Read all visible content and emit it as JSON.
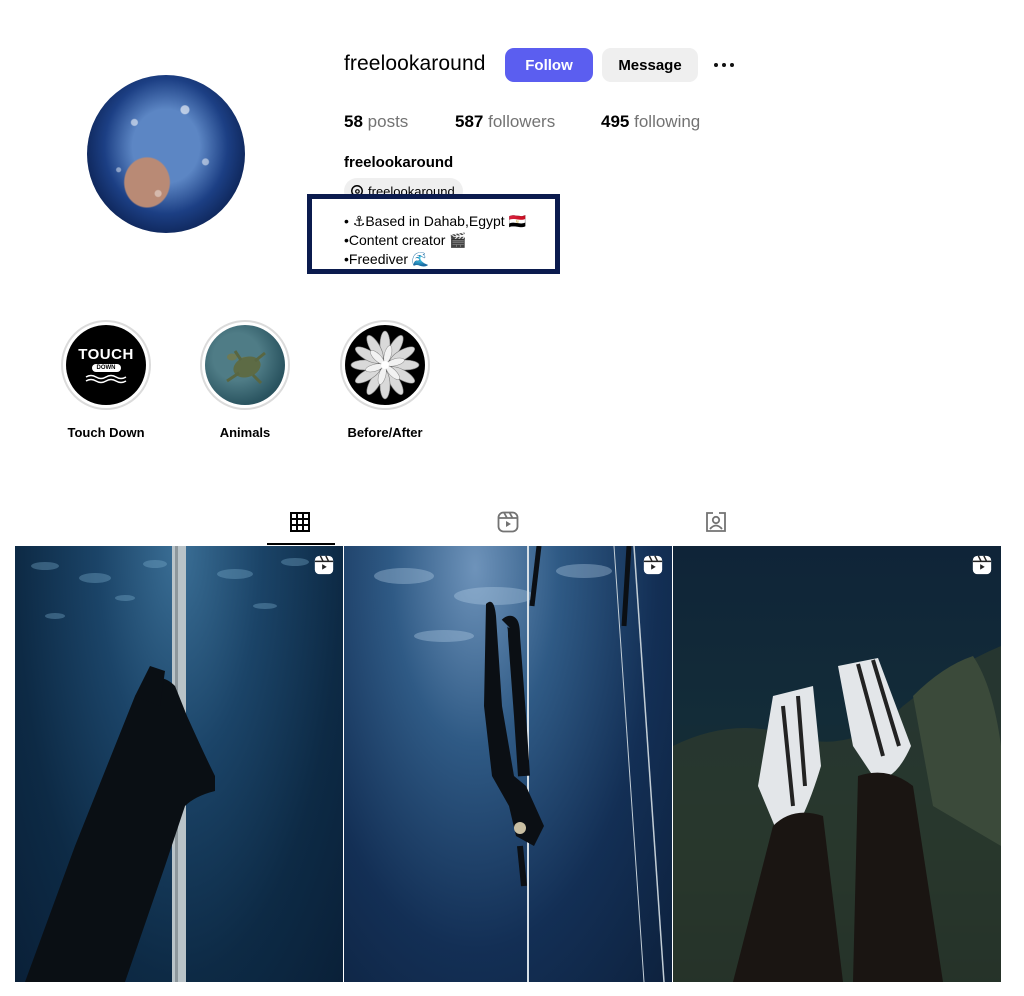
{
  "profile": {
    "username": "freelookaround",
    "follow_label": "Follow",
    "message_label": "Message",
    "stats": [
      {
        "count": "58",
        "label": "posts"
      },
      {
        "count": "587",
        "label": "followers"
      },
      {
        "count": "495",
        "label": "following"
      }
    ],
    "display_name": "freelookaround",
    "threads_handle": "freelookaround",
    "bio": [
      "• ⚓Based in Dahab,Egypt 🇪🇬",
      "•Content creator 🎬",
      "•Freediver 🌊"
    ]
  },
  "highlights": [
    {
      "label": "Touch Down",
      "cover_text": "TOUCH",
      "cover_subtext": "DOWN"
    },
    {
      "label": "Animals"
    },
    {
      "label": "Before/After"
    }
  ],
  "tabs": [
    {
      "name": "posts",
      "icon": "grid-icon",
      "active": true
    },
    {
      "name": "reels",
      "icon": "reels-icon",
      "active": false
    },
    {
      "name": "tagged",
      "icon": "tagged-user-icon",
      "active": false
    }
  ],
  "posts": [
    {
      "type": "reel",
      "icon": "reel-icon"
    },
    {
      "type": "reel",
      "icon": "reel-icon"
    },
    {
      "type": "reel",
      "icon": "reel-icon"
    }
  ],
  "colors": {
    "follow_button": "#5b5ef0",
    "message_button": "#efefef",
    "bio_box_border": "#0b1b4e"
  }
}
